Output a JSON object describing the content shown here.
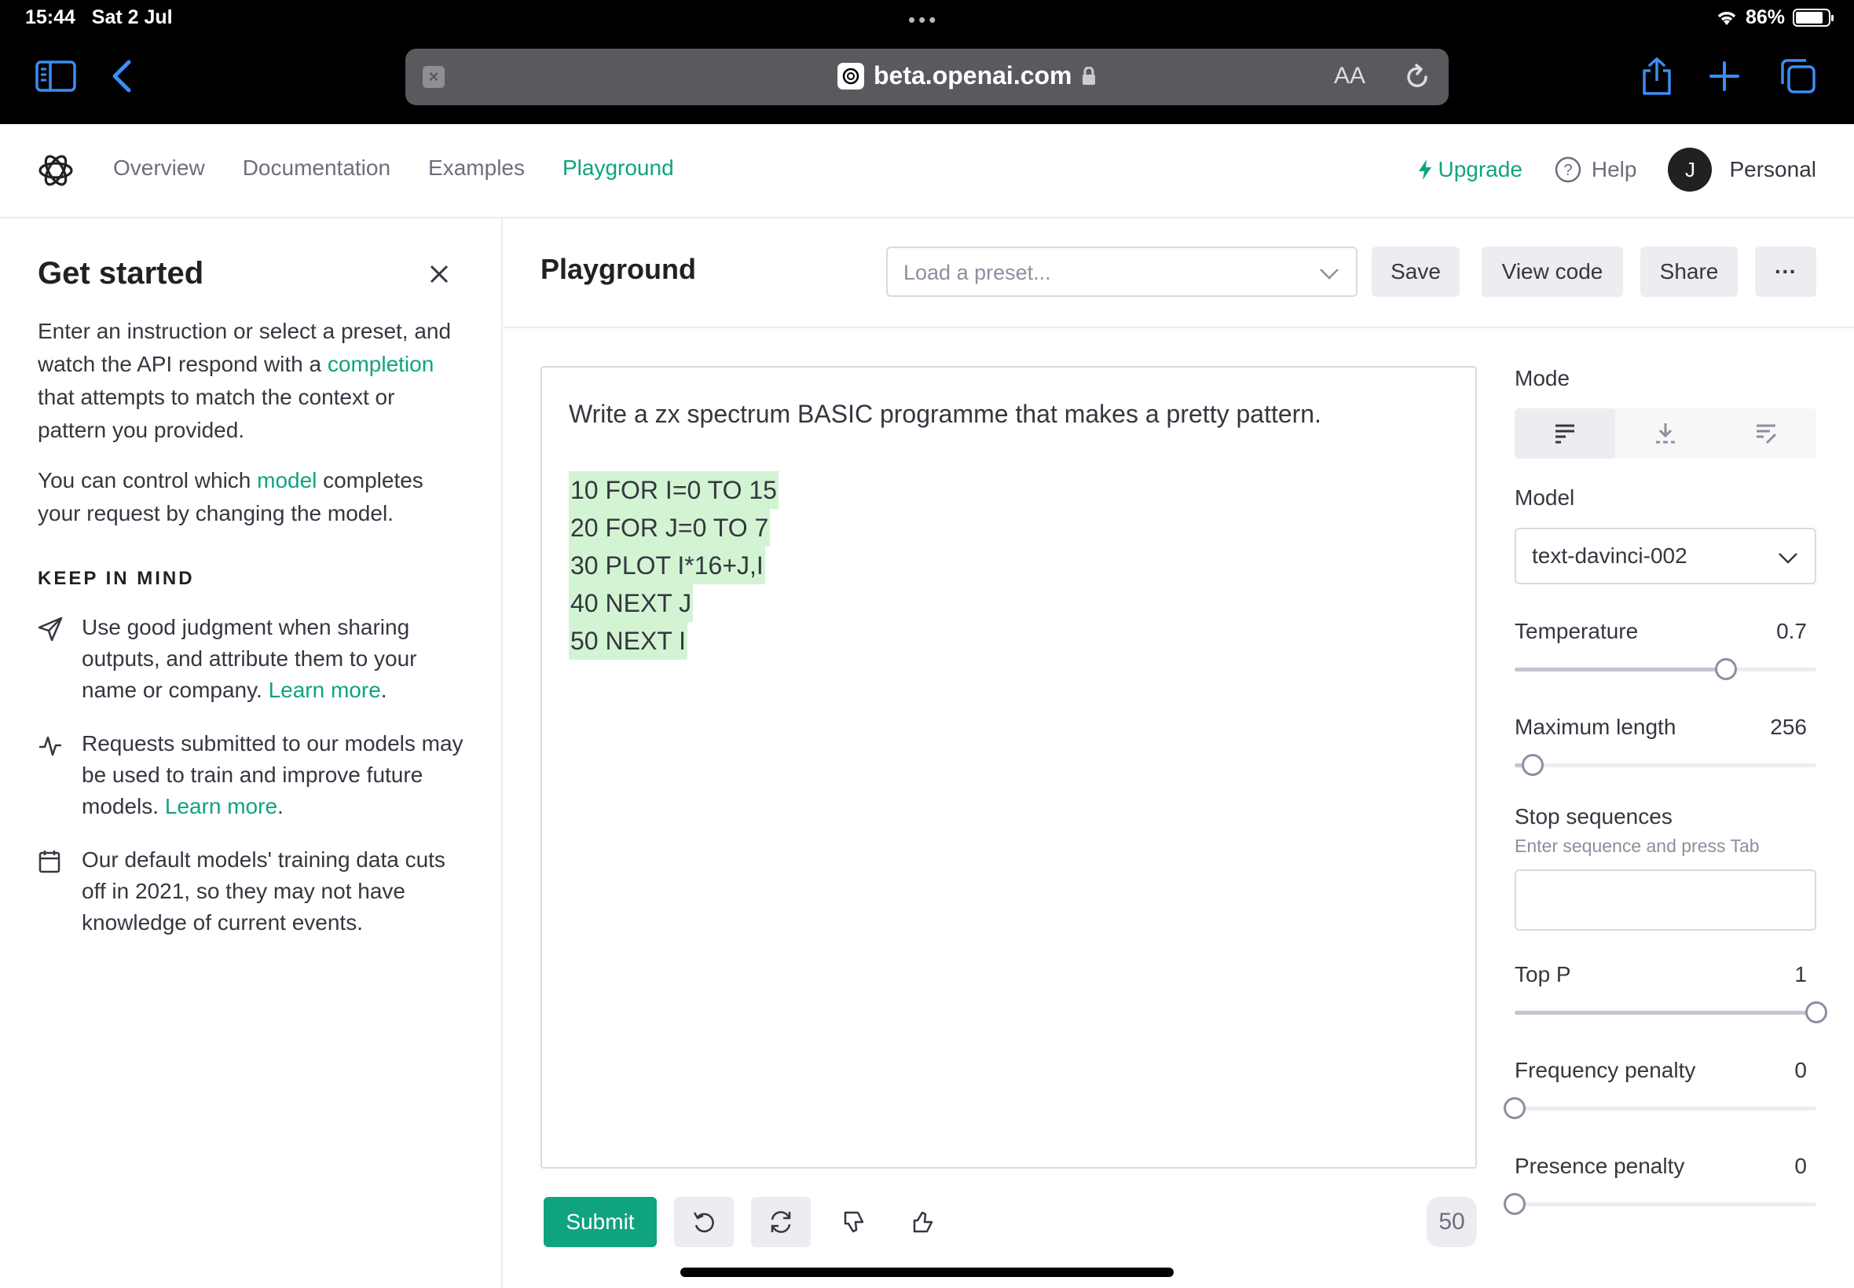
{
  "status": {
    "time": "15:44",
    "date": "Sat 2 Jul",
    "battery_text": "86%",
    "battery_level": 0.86
  },
  "browser": {
    "url": "beta.openai.com",
    "reader_label": "AA"
  },
  "nav": {
    "links": [
      "Overview",
      "Documentation",
      "Examples",
      "Playground"
    ],
    "active": "Playground",
    "upgrade": "Upgrade",
    "help": "Help",
    "avatar_initial": "J",
    "account": "Personal"
  },
  "sidebar": {
    "title": "Get started",
    "intro_1": "Enter an instruction or select a preset, and watch the API respond with a ",
    "intro_link": "completion",
    "intro_2": " that attempts to match the context or pattern you provided.",
    "model_1": "You can control which ",
    "model_link": "model",
    "model_2": " completes your request by changing the model.",
    "keep_heading": "KEEP IN MIND",
    "tips": [
      {
        "icon": "send-icon",
        "text": "Use good judgment when sharing outputs, and attribute them to your name or company. ",
        "link": "Learn more",
        "after": "."
      },
      {
        "icon": "activity-icon",
        "text": "Requests submitted to our models may be used to train and improve future models. ",
        "link": "Learn more",
        "after": "."
      },
      {
        "icon": "calendar-icon",
        "text": "Our default models' training data cuts off in 2021, so they may not have knowledge of current events.",
        "link": "",
        "after": ""
      }
    ]
  },
  "header": {
    "title": "Playground",
    "preset_placeholder": "Load a preset...",
    "save": "Save",
    "view_code": "View code",
    "share": "Share",
    "more": "···"
  },
  "editor": {
    "prompt": "Write a zx spectrum BASIC programme that makes a pretty pattern.",
    "completion": [
      "10 FOR I=0 TO 15",
      "20 FOR J=0 TO 7",
      "30 PLOT I*16+J,I",
      "40 NEXT J",
      "50 NEXT I"
    ]
  },
  "footer": {
    "submit": "Submit",
    "token_count": "50"
  },
  "settings": {
    "mode_label": "Mode",
    "mode_options": [
      "complete-icon",
      "insert-icon",
      "edit-icon"
    ],
    "mode_selected": 0,
    "model_label": "Model",
    "model_value": "text-davinci-002",
    "temperature": {
      "label": "Temperature",
      "value": "0.7",
      "fraction": 0.7
    },
    "max_length": {
      "label": "Maximum length",
      "value": "256",
      "fraction": 0.06
    },
    "stop": {
      "label": "Stop sequences",
      "hint": "Enter sequence and press Tab"
    },
    "top_p": {
      "label": "Top P",
      "value": "1",
      "fraction": 1.0
    },
    "frequency": {
      "label": "Frequency penalty",
      "value": "0",
      "fraction": 0.0
    },
    "presence": {
      "label": "Presence penalty",
      "value": "0",
      "fraction": 0.0
    }
  },
  "colors": {
    "accent": "#10a37f",
    "highlight": "#d2f4d3",
    "dark": "#202123"
  }
}
